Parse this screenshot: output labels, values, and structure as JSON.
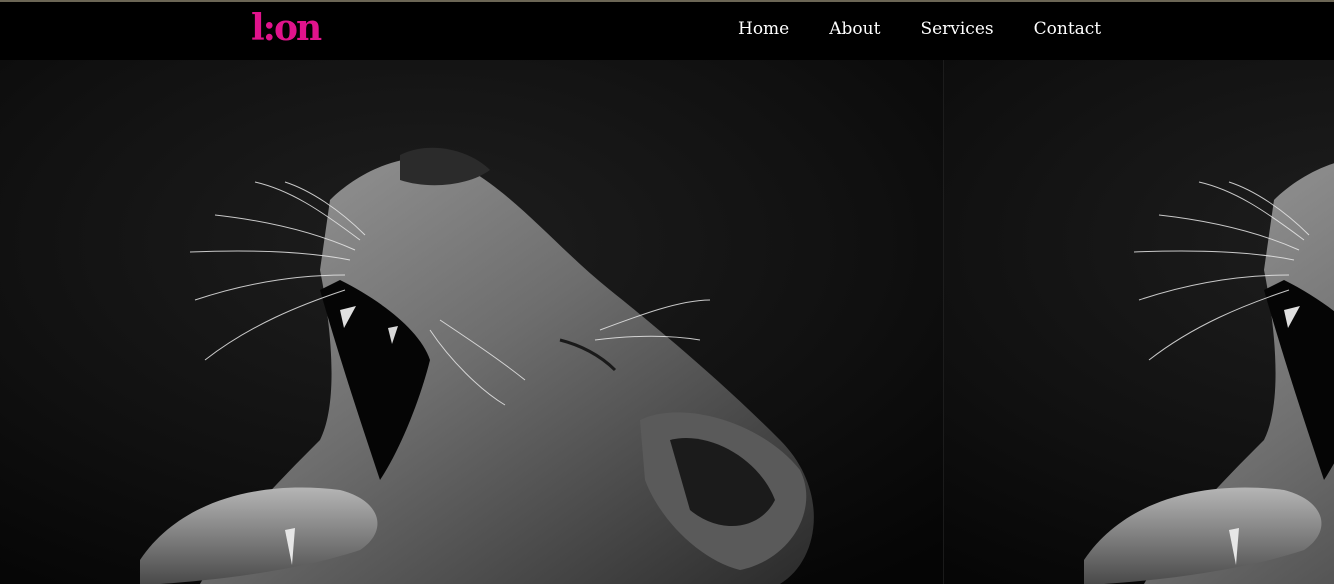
{
  "header": {
    "logo_text": "l:on",
    "logo_color": "#e0138c",
    "nav": [
      {
        "label": "Home"
      },
      {
        "label": "About"
      },
      {
        "label": "Services"
      },
      {
        "label": "Contact"
      }
    ]
  },
  "hero": {
    "image_subject": "yawning-lioness-black-and-white-photo",
    "tiling": "repeat-x"
  },
  "colors": {
    "nav_background": "#000000",
    "nav_text": "#ffffff",
    "accent": "#e0138c",
    "top_rule": "#6b6655"
  }
}
